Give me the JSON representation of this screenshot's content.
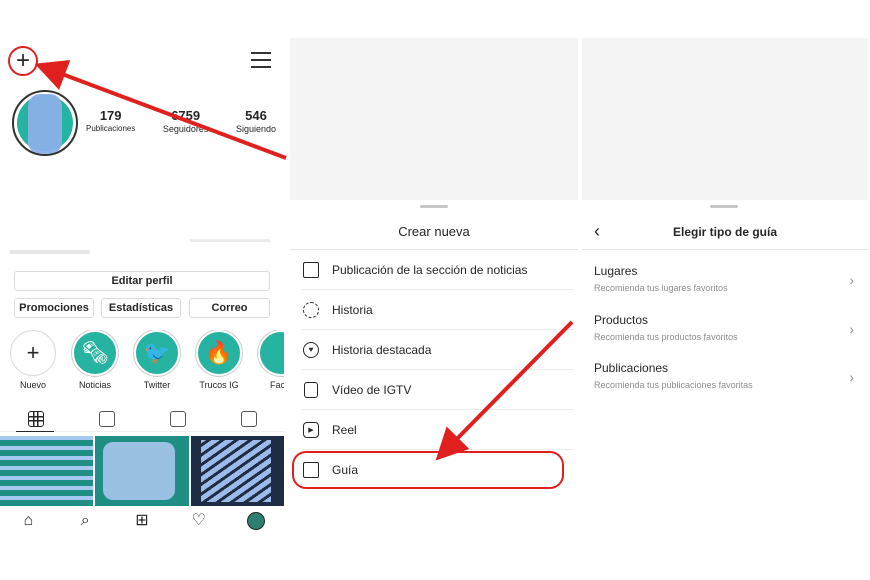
{
  "profile": {
    "new_post_icon": "+",
    "stats": [
      {
        "value": "179",
        "label": "Publicaciones"
      },
      {
        "value": "6759",
        "label": "Seguidores"
      },
      {
        "value": "546",
        "label": "Siguiendo"
      }
    ],
    "edit_profile": "Editar perfil",
    "action_buttons": [
      "Promociones",
      "Estadísticas",
      "Correo"
    ],
    "highlights": [
      {
        "label": "Nuevo",
        "icon": "+"
      },
      {
        "label": "Noticias",
        "icon": "🗞"
      },
      {
        "label": "Twitter",
        "icon": "🐦"
      },
      {
        "label": "Trucos IG",
        "icon": "🔥"
      },
      {
        "label": "Facel",
        "icon": ""
      }
    ]
  },
  "create_sheet": {
    "title": "Crear nueva",
    "items": [
      {
        "label": "Publicación de la sección de noticias",
        "icon": "grid-icon"
      },
      {
        "label": "Historia",
        "icon": "story-icon"
      },
      {
        "label": "Historia destacada",
        "icon": "highlight-icon"
      },
      {
        "label": "Vídeo de IGTV",
        "icon": "igtv-icon"
      },
      {
        "label": "Reel",
        "icon": "reel-icon"
      },
      {
        "label": "Guía",
        "icon": "guide-icon"
      }
    ]
  },
  "guide_sheet": {
    "title": "Elegir tipo de guía",
    "back_icon": "‹",
    "options": [
      {
        "title": "Lugares",
        "subtitle": "Recomienda tus lugares favoritos"
      },
      {
        "title": "Productos",
        "subtitle": "Recomienda tus productos favoritos"
      },
      {
        "title": "Publicaciones",
        "subtitle": "Recomienda tus publicaciones favoritas"
      }
    ]
  },
  "colors": {
    "annotation_red": "#e0201f",
    "accent_teal": "#26b3a1"
  }
}
